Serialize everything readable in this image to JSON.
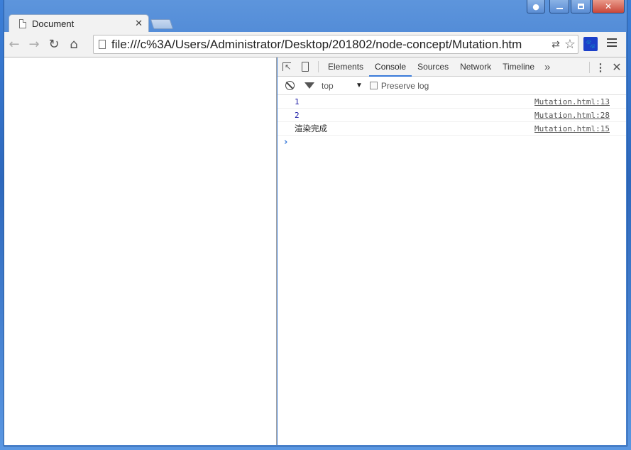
{
  "window": {
    "caption_buttons": [
      "user",
      "minimize",
      "maximize",
      "close"
    ]
  },
  "tab": {
    "title": "Document",
    "close_glyph": "✕"
  },
  "toolbar": {
    "back_icon": "arrow-left-icon",
    "forward_icon": "arrow-right-icon",
    "reload_icon": "reload-icon",
    "home_icon": "home-icon",
    "url": "file:///c%3A/Users/Administrator/Desktop/201802/node-concept/Mutation.htm",
    "extension_label": "🐾"
  },
  "devtools": {
    "tabs": [
      "Elements",
      "Console",
      "Sources",
      "Network",
      "Timeline"
    ],
    "active_tab": "Console",
    "more_glyph": "»",
    "context": "top",
    "preserve_log_label": "Preserve log",
    "preserve_log_checked": false,
    "console_entries": [
      {
        "message": "1",
        "source": "Mutation.html:13",
        "kind": "num"
      },
      {
        "message": "2",
        "source": "Mutation.html:28",
        "kind": "num"
      },
      {
        "message": "渲染完成",
        "source": "Mutation.html:15",
        "kind": "text"
      }
    ],
    "prompt_glyph": "›"
  },
  "colors": {
    "accent": "#3879d9",
    "number_value": "#1a1aa6",
    "window_frame": "#4c86d4"
  }
}
